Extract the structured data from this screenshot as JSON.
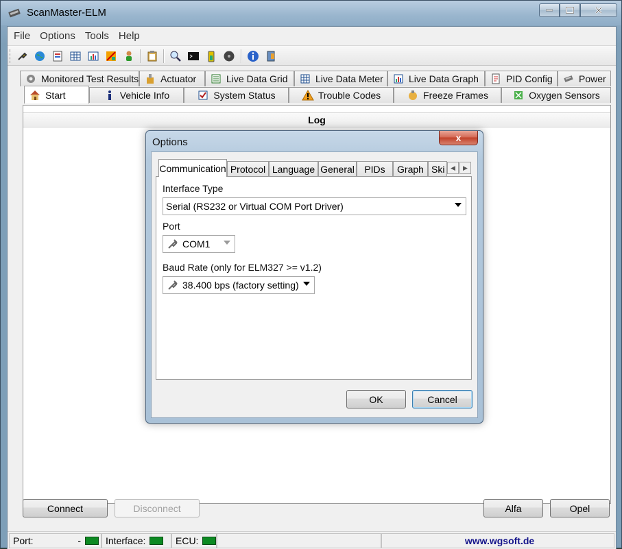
{
  "window": {
    "title": "ScanMaster-ELM"
  },
  "menu": [
    "File",
    "Options",
    "Tools",
    "Help"
  ],
  "toolbar": {
    "icons": [
      "connect-plug-icon",
      "globe-icon",
      "report-icon",
      "grid-icon",
      "chart-icon",
      "sensors-icon",
      "person-icon",
      "clipboard-icon",
      "search-icon",
      "terminal-icon",
      "battery-icon",
      "disc-icon",
      "info-icon",
      "exit-icon"
    ]
  },
  "tabs": {
    "row_back": [
      {
        "label": "Monitored Test Results",
        "icon": "gear-icon"
      },
      {
        "label": "Actuator",
        "icon": "actuator-icon"
      },
      {
        "label": "Live Data Grid",
        "icon": "list-icon"
      },
      {
        "label": "Live Data Meter",
        "icon": "meter-icon"
      },
      {
        "label": "Live Data Graph",
        "icon": "graph-icon"
      },
      {
        "label": "PID Config",
        "icon": "doc-icon"
      },
      {
        "label": "Power",
        "icon": "chip-icon"
      }
    ],
    "row_front": [
      {
        "label": "Start",
        "icon": "home-icon"
      },
      {
        "label": "Vehicle Info",
        "icon": "info-icon"
      },
      {
        "label": "System Status",
        "icon": "checkbox-icon"
      },
      {
        "label": "Trouble Codes",
        "icon": "warning-icon"
      },
      {
        "label": "Freeze Frames",
        "icon": "snapshot-icon"
      },
      {
        "label": "Oxygen Sensors",
        "icon": "sensor-icon"
      }
    ]
  },
  "log": {
    "title": "Log"
  },
  "buttons": {
    "connect": "Connect",
    "disconnect": "Disconnect",
    "alfa": "Alfa",
    "opel": "Opel"
  },
  "status": {
    "port_label": "Port:",
    "port_value": "-",
    "interface_label": "Interface:",
    "ecu_label": "ECU:",
    "url": "www.wgsoft.de",
    "led_color": "#0d8a23"
  },
  "dialog": {
    "title": "Options",
    "close": "x",
    "tabs": [
      "Communication",
      "Protocol",
      "Language",
      "General",
      "PIDs",
      "Graph",
      "Ski"
    ],
    "interface_type_label": "Interface Type",
    "interface_type_value": "Serial (RS232 or Virtual COM Port Driver)",
    "port_label": "Port",
    "port_value": "COM1",
    "baud_label": "Baud Rate (only for ELM327 >= v1.2)",
    "baud_value": "38.400 bps (factory setting)",
    "ok": "OK",
    "cancel": "Cancel"
  }
}
